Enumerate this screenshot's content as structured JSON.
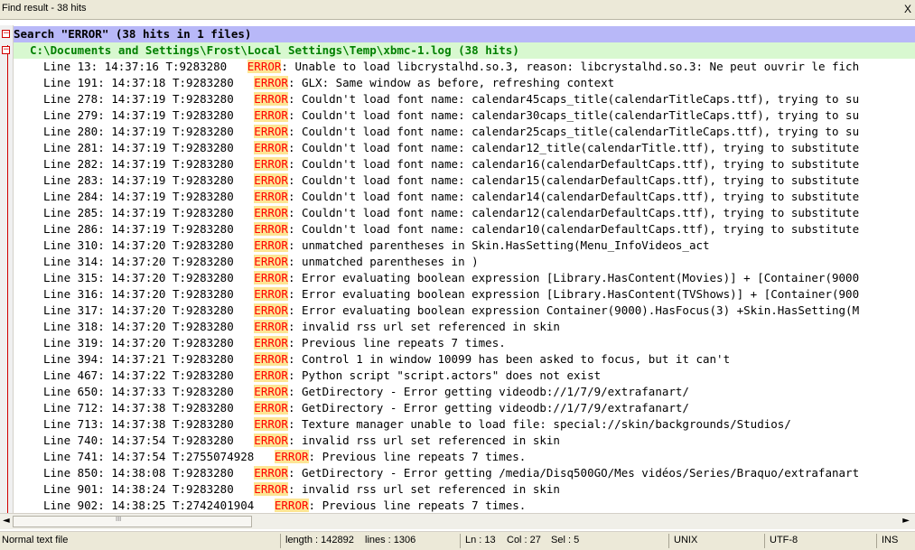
{
  "window": {
    "title": "Find result - 38 hits",
    "close_label": "X"
  },
  "search_header": "Search \"ERROR\" (38 hits in 1 files)",
  "file_header": "C:\\Documents and Settings\\Frost\\Local Settings\\Temp\\xbmc-1.log (38 hits)",
  "fold_symbol": "−",
  "results": [
    {
      "prefix": "Line 13: 14:37:16 T:9283280   ",
      "error": "ERROR",
      "message": ": Unable to load libcrystalhd.so.3, reason: libcrystalhd.so.3: Ne peut ouvrir le fich"
    },
    {
      "prefix": "Line 191: 14:37:18 T:9283280   ",
      "error": "ERROR",
      "message": ": GLX: Same window as before, refreshing context"
    },
    {
      "prefix": "Line 278: 14:37:19 T:9283280   ",
      "error": "ERROR",
      "message": ": Couldn't load font name: calendar45caps_title(calendarTitleCaps.ttf), trying to su"
    },
    {
      "prefix": "Line 279: 14:37:19 T:9283280   ",
      "error": "ERROR",
      "message": ": Couldn't load font name: calendar30caps_title(calendarTitleCaps.ttf), trying to su"
    },
    {
      "prefix": "Line 280: 14:37:19 T:9283280   ",
      "error": "ERROR",
      "message": ": Couldn't load font name: calendar25caps_title(calendarTitleCaps.ttf), trying to su"
    },
    {
      "prefix": "Line 281: 14:37:19 T:9283280   ",
      "error": "ERROR",
      "message": ": Couldn't load font name: calendar12_title(calendarTitle.ttf), trying to substitute"
    },
    {
      "prefix": "Line 282: 14:37:19 T:9283280   ",
      "error": "ERROR",
      "message": ": Couldn't load font name: calendar16(calendarDefaultCaps.ttf), trying to substitute"
    },
    {
      "prefix": "Line 283: 14:37:19 T:9283280   ",
      "error": "ERROR",
      "message": ": Couldn't load font name: calendar15(calendarDefaultCaps.ttf), trying to substitute"
    },
    {
      "prefix": "Line 284: 14:37:19 T:9283280   ",
      "error": "ERROR",
      "message": ": Couldn't load font name: calendar14(calendarDefaultCaps.ttf), trying to substitute"
    },
    {
      "prefix": "Line 285: 14:37:19 T:9283280   ",
      "error": "ERROR",
      "message": ": Couldn't load font name: calendar12(calendarDefaultCaps.ttf), trying to substitute"
    },
    {
      "prefix": "Line 286: 14:37:19 T:9283280   ",
      "error": "ERROR",
      "message": ": Couldn't load font name: calendar10(calendarDefaultCaps.ttf), trying to substitute"
    },
    {
      "prefix": "Line 310: 14:37:20 T:9283280   ",
      "error": "ERROR",
      "message": ": unmatched parentheses in Skin.HasSetting(Menu_InfoVideos_act"
    },
    {
      "prefix": "Line 314: 14:37:20 T:9283280   ",
      "error": "ERROR",
      "message": ": unmatched parentheses in )"
    },
    {
      "prefix": "Line 315: 14:37:20 T:9283280   ",
      "error": "ERROR",
      "message": ": Error evaluating boolean expression [Library.HasContent(Movies)] + [Container(9000"
    },
    {
      "prefix": "Line 316: 14:37:20 T:9283280   ",
      "error": "ERROR",
      "message": ": Error evaluating boolean expression [Library.HasContent(TVShows)] + [Container(900"
    },
    {
      "prefix": "Line 317: 14:37:20 T:9283280   ",
      "error": "ERROR",
      "message": ": Error evaluating boolean expression Container(9000).HasFocus(3) +Skin.HasSetting(M"
    },
    {
      "prefix": "Line 318: 14:37:20 T:9283280   ",
      "error": "ERROR",
      "message": ": invalid rss url set referenced in skin"
    },
    {
      "prefix": "Line 319: 14:37:20 T:9283280   ",
      "error": "ERROR",
      "message": ": Previous line repeats 7 times."
    },
    {
      "prefix": "Line 394: 14:37:21 T:9283280   ",
      "error": "ERROR",
      "message": ": Control 1 in window 10099 has been asked to focus, but it can't"
    },
    {
      "prefix": "Line 467: 14:37:22 T:9283280   ",
      "error": "ERROR",
      "message": ": Python script \"script.actors\" does not exist"
    },
    {
      "prefix": "Line 650: 14:37:33 T:9283280   ",
      "error": "ERROR",
      "message": ": GetDirectory - Error getting videodb://1/7/9/extrafanart/"
    },
    {
      "prefix": "Line 712: 14:37:38 T:9283280   ",
      "error": "ERROR",
      "message": ": GetDirectory - Error getting videodb://1/7/9/extrafanart/"
    },
    {
      "prefix": "Line 713: 14:37:38 T:9283280   ",
      "error": "ERROR",
      "message": ": Texture manager unable to load file: special://skin/backgrounds/Studios/"
    },
    {
      "prefix": "Line 740: 14:37:54 T:9283280   ",
      "error": "ERROR",
      "message": ": invalid rss url set referenced in skin"
    },
    {
      "prefix": "Line 741: 14:37:54 T:2755074928   ",
      "error": "ERROR",
      "message": ": Previous line repeats 7 times."
    },
    {
      "prefix": "Line 850: 14:38:08 T:9283280   ",
      "error": "ERROR",
      "message": ": GetDirectory - Error getting /media/Disq500GO/Mes vidéos/Series/Braquo/extrafanart"
    },
    {
      "prefix": "Line 901: 14:38:24 T:9283280   ",
      "error": "ERROR",
      "message": ": invalid rss url set referenced in skin"
    },
    {
      "prefix": "Line 902: 14:38:25 T:2742401904   ",
      "error": "ERROR",
      "message": ": Previous line repeats 7 times."
    }
  ],
  "scrollbar": {
    "left_arrow": "◄",
    "right_arrow": "►",
    "grip": "III"
  },
  "statusbar": {
    "file_type": "Normal text file",
    "length": "length : 142892",
    "lines": "lines : 1306",
    "ln": "Ln : 13",
    "col": "Col : 27",
    "sel": "Sel : 5",
    "eol": "UNIX",
    "encoding": "UTF-8",
    "mode": "INS"
  }
}
